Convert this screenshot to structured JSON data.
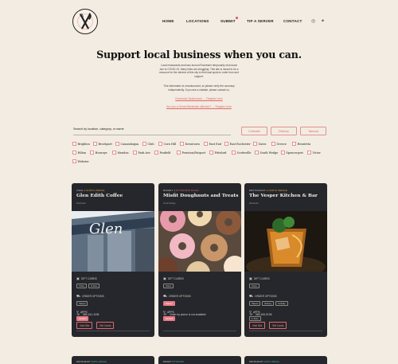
{
  "nav": {
    "items": [
      "HOME",
      "LOCATIONS",
      "SUBMIT",
      "TIP A SERVER",
      "CONTACT"
    ],
    "social": [
      "instagram-icon",
      "twitter-icon"
    ]
  },
  "hero": {
    "title": "Support local business when you can.",
    "paragraph1": [
      "Local restaurants and bars around Rochester temporarily shut down",
      "due to COVID-19. Many folks are struggling. This site is meant to be a",
      "resource for the citizens of this city to find local spots to order from and",
      "support."
    ],
    "paragraph2": [
      "This information is crowdsourced, so please verify the accuracy",
      "independently. If you see a mistake, please contact us."
    ],
    "link1": "Rochester Businesses → Register here",
    "link2": "Are you a Server/Bartender affected? → Register here"
  },
  "search": {
    "label": "Search by location, category, or name",
    "buttons": [
      "Curbside",
      "Delivery",
      "Takeout"
    ]
  },
  "neighborhoods": [
    [
      "Brighton",
      "Brockport",
      "Canandaigua",
      "Chili",
      "Corn Hill",
      "Downtown",
      "East End",
      "East Rochester",
      "Gates",
      "Greece",
      "Henrietta"
    ],
    [
      "Hilton",
      "Honeoye",
      "Mendon",
      "Park Ave",
      "Penfield",
      "Perinton/Fairport",
      "Pittsford",
      "Scottsville",
      "South Wedge",
      "Spencerport",
      "Victor"
    ],
    [
      "Webster"
    ]
  ],
  "cards": [
    {
      "category": "CAFE",
      "subcategory": "NORTH WEDGE",
      "title": "Glen Edith Coffee",
      "location": "Rochester",
      "gift_cards_label": "GIFT CARDS",
      "gift_cards": [
        "Online",
        "In Store"
      ],
      "order_label": "ORDER OPTIONS",
      "order": [
        "Takeout"
      ],
      "apps_label": "APPS",
      "apps": [
        "Grubhub"
      ],
      "phone": "585-441-1198",
      "buttons": [
        "Visit Site",
        "Gift Cards"
      ]
    },
    {
      "category": "BAKERY",
      "subcategory": "PITTSFORD PLAZA",
      "title": "Misfit Doughnuts and Treats",
      "location": "South Wedge",
      "gift_cards_label": "GIFT CARDS",
      "gift_cards": [
        "Online"
      ],
      "order_label": "ORDER OPTIONS",
      "order": [
        "Delivery"
      ],
      "apps_label": "APPS",
      "apps": [
        "Grubhub"
      ],
      "phone": "Order by phone is not available",
      "buttons": []
    },
    {
      "category": "RESTAURANT",
      "subcategory": "NORTH WEDGE",
      "title": "The Vesper Kitchen & Bar",
      "location": "Rochester",
      "gift_cards_label": "GIFT CARDS",
      "gift_cards": [
        "Online"
      ],
      "order_label": "ORDER OPTIONS",
      "order": [
        "Takeout",
        "Delivery",
        "Curbside"
      ],
      "apps_label": "APPS",
      "apps": [
        "In-Store"
      ],
      "phone": "585-454-9196",
      "buttons": [
        "Visit Site",
        "Gift Cards"
      ]
    }
  ],
  "more_cards": [
    {
      "category": "RESTAURANT",
      "subcategory": "NORTH WEDGE"
    },
    {
      "category": "BAKERY",
      "subcategory": "PITTSFORD"
    },
    {
      "category": "RESTAURANT",
      "subcategory": "NORTH WEDGE"
    }
  ],
  "colors": {
    "background": "#f2ece2",
    "card": "#26272c",
    "accent": "#e06a6a",
    "highlight": "#e6a23c"
  }
}
